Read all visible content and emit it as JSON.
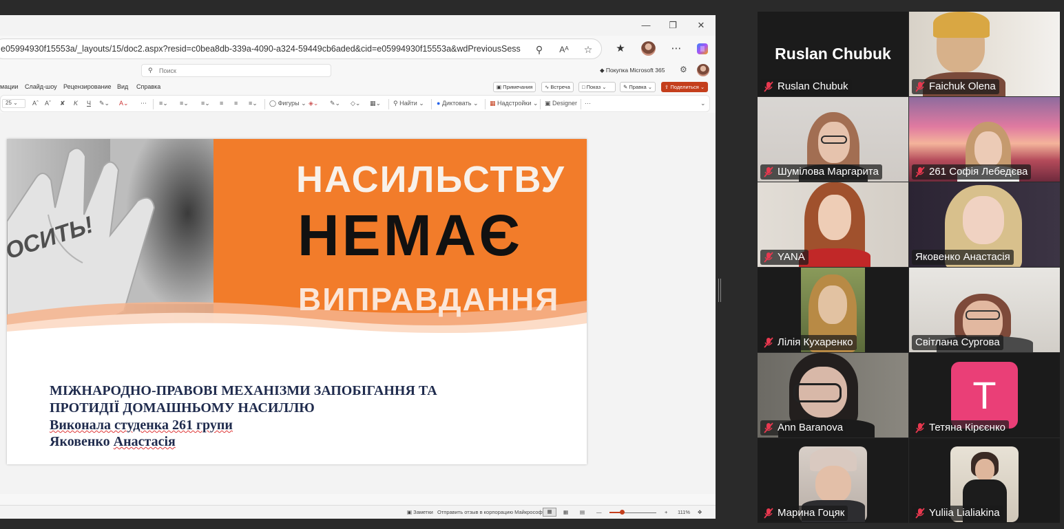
{
  "browser": {
    "url": "e05994930f15553a/_layouts/15/doc2.aspx?resid=c0bea8db-339a-4090-a324-59449cb6aded&cid=e05994930f15553a&wdPreviousSessio...",
    "read_aloud_label": "Aᴬ"
  },
  "office": {
    "search_placeholder": "Поиск",
    "ms365_label": "Покупка Microsoft 365",
    "menu": [
      "мации",
      "Слайд-шоу",
      "Рецензирование",
      "Вид",
      "Справка"
    ],
    "right_buttons": {
      "comments": "Примечания",
      "meeting": "Встреча",
      "present": "Показ",
      "edit": "Правка",
      "share": "Поделиться"
    },
    "toolbar": {
      "font_size": "25",
      "shapes": "Фигуры",
      "find": "Найти",
      "dictate": "Диктовать",
      "addins": "Надстройки",
      "designer": "Designer",
      "more": "···"
    },
    "status": {
      "notes": "Заметки",
      "feedback": "Отправить отзыв в корпорацию Майкрософт",
      "zoom": "111%"
    }
  },
  "slide": {
    "banner_line1": "НАСИЛЬСТВУ",
    "banner_line2": "НЕМАЄ",
    "banner_line3": "ВИПРАВДАННЯ",
    "hand_text": "ОСИТЬ!",
    "title_line1": "МІЖНАРОДНО-ПРАВОВІ МЕХАНІЗМИ ЗАПОБІГАННЯ ТА",
    "title_line2": "ПРОТИДІЇ ДОМАШНЬОМУ НАСИЛЛЮ",
    "author_line1": "Виконала студенка 261 групи",
    "author_line2_a": "Яковенко",
    "author_line2_b": "Анастасія"
  },
  "meeting": {
    "participants": [
      {
        "name": "Ruslan Chubuk",
        "display": "Ruslan Chubuk",
        "muted": true,
        "video": false
      },
      {
        "name": "Faichuk Olena",
        "muted": true,
        "video": true
      },
      {
        "name": "Шумілова Маргарита",
        "muted": true,
        "video": true
      },
      {
        "name": "261 Софія Лебедєва",
        "muted": true,
        "video": true
      },
      {
        "name": "YANA",
        "muted": true,
        "video": true
      },
      {
        "name": "Яковенко Анастасія",
        "muted": false,
        "video": true,
        "speaking": true
      },
      {
        "name": "Лілія Кухаренко",
        "muted": true,
        "video": true
      },
      {
        "name": "Світлана Сургова",
        "muted": false,
        "video": true
      },
      {
        "name": "Ann Baranova",
        "muted": true,
        "video": true
      },
      {
        "name": "Тетяна Кірєєнко",
        "initial": "T",
        "muted": true,
        "video": false
      },
      {
        "name": "Марина Гоцяк",
        "muted": true,
        "video": true
      },
      {
        "name": "Yuliia Lialiakina",
        "muted": true,
        "video": true
      }
    ],
    "colors": {
      "speaking_outline": "#28d17c",
      "avatar_bg": "#ea3f77",
      "muted_icon": "#e8384f"
    }
  }
}
